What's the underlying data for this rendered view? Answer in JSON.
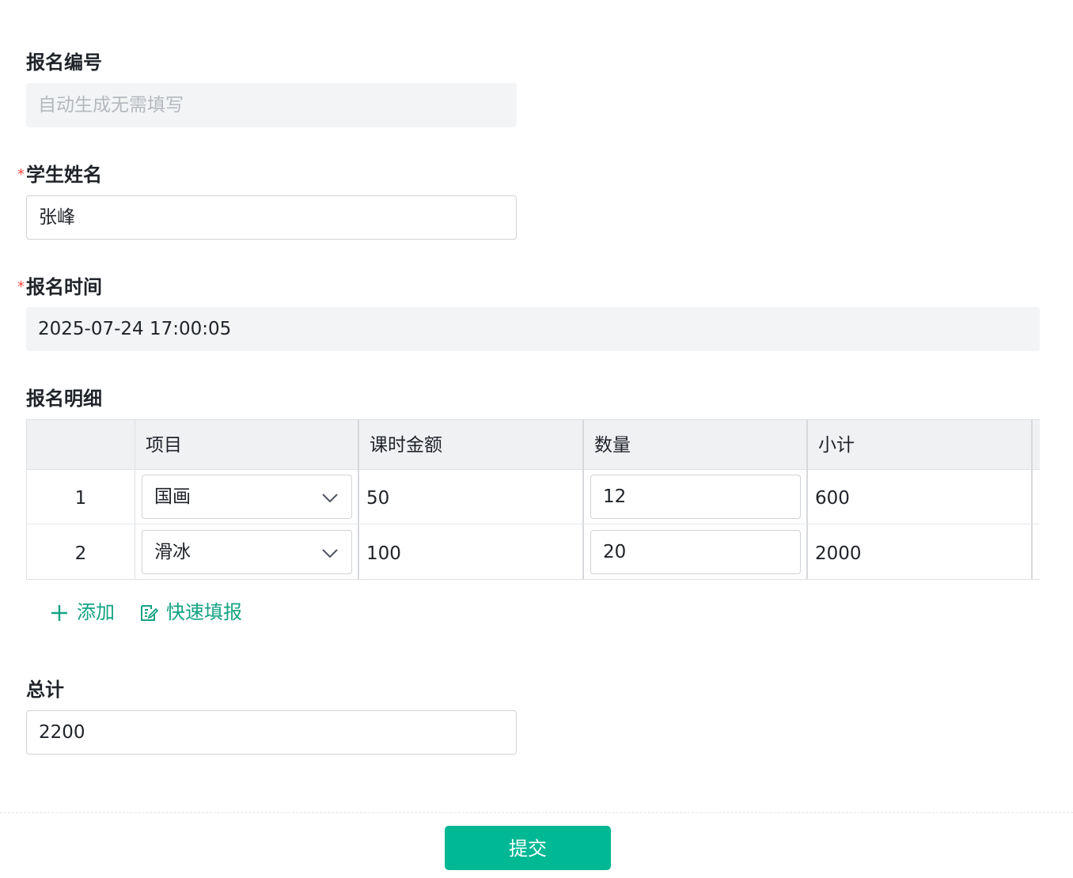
{
  "form": {
    "registration_no": {
      "label": "报名编号",
      "placeholder": "自动生成无需填写"
    },
    "student_name": {
      "label": "学生姓名",
      "required_mark": "*",
      "value": "张峰"
    },
    "registration_time": {
      "label": "报名时间",
      "required_mark": "*",
      "value": "2025-07-24 17:00:05"
    },
    "details": {
      "label": "报名明细",
      "columns": [
        "",
        "项目",
        "课时金额",
        "数量",
        "小计"
      ],
      "rows": [
        {
          "index": "1",
          "item": "国画",
          "price": "50",
          "quantity": "12",
          "subtotal": "600"
        },
        {
          "index": "2",
          "item": "滑冰",
          "price": "100",
          "quantity": "20",
          "subtotal": "2000"
        }
      ],
      "add_label": "添加",
      "quick_fill_label": "快速填报"
    },
    "total": {
      "label": "总计",
      "value": "2200"
    },
    "submit_label": "提交"
  },
  "colors": {
    "accent": "#00b894",
    "link": "#14a384",
    "required": "#f54a45"
  },
  "icons": {
    "select_arrow": "chevron-down-icon",
    "add": "plus-icon",
    "quick_fill": "edit-form-icon"
  }
}
